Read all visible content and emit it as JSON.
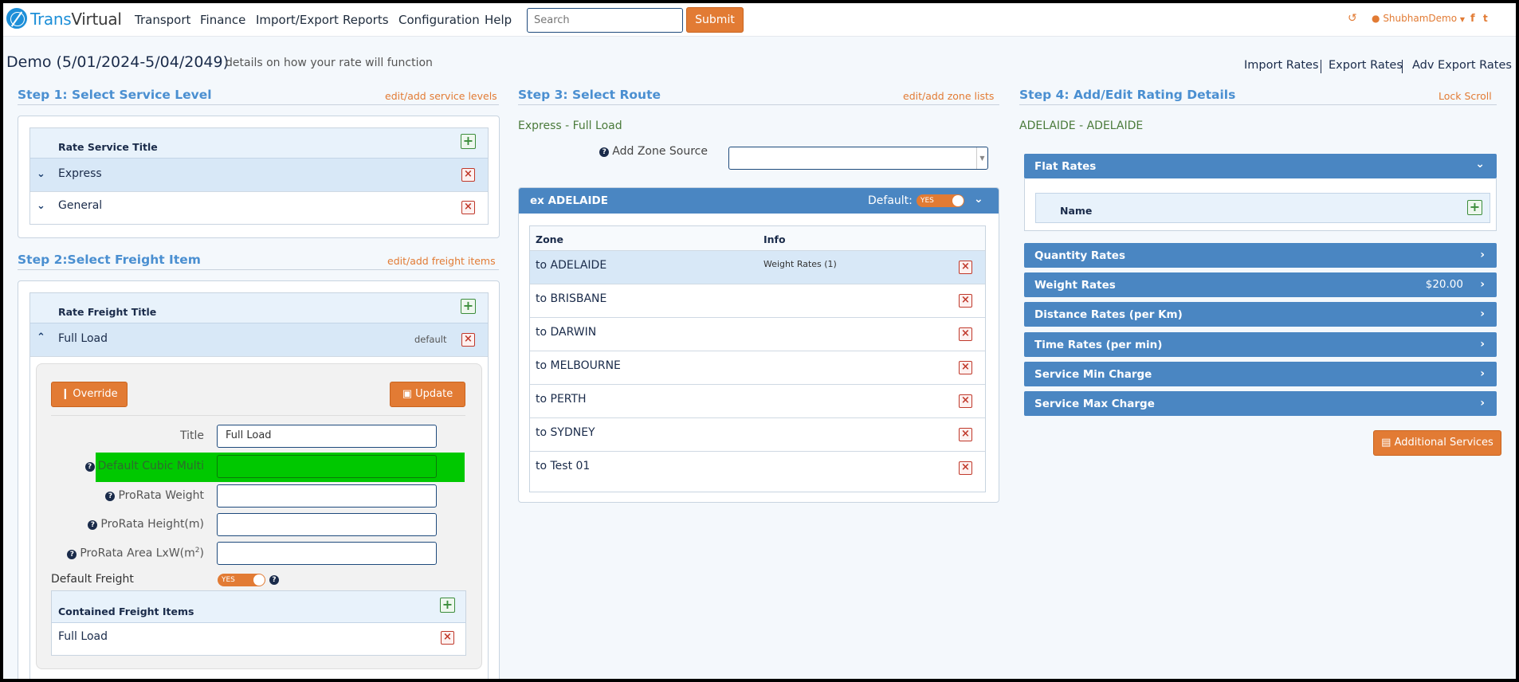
{
  "navbar": {
    "logo_trans": "Trans",
    "logo_virtual": "Virtual",
    "menu": [
      "Transport",
      "Finance",
      "Import/Export",
      "Reports",
      "Configuration",
      "Help"
    ],
    "search_placeholder": "Search",
    "submit_label": "Submit",
    "user": "ShubhamDemo",
    "icons": [
      "history-icon",
      "user-icon",
      "facebook-icon",
      "twitter-icon"
    ]
  },
  "header": {
    "title": "Demo (5/01/2024-5/04/2049)",
    "subtitle": "details on how your rate will function",
    "links": [
      "Import Rates",
      "Export Rates",
      "Adv Export Rates"
    ]
  },
  "step1": {
    "title": "Step 1: Select Service Level",
    "link": "edit/add service levels",
    "column": "Rate Service Title",
    "rows": [
      "Express",
      "General"
    ]
  },
  "step2": {
    "title": "Step 2:Select Freight Item",
    "link": "edit/add freight items",
    "column": "Rate Freight Title",
    "row": "Full Load",
    "row_badge": "default",
    "override_label": "Override",
    "update_label": "Update",
    "fields": {
      "title_label": "Title",
      "title_value": "Full Load",
      "cubic_label": "Default Cubic Multi",
      "prorata_weight_label": "ProRata Weight",
      "prorata_height_label": "ProRata Height(m)",
      "prorata_area_label": "ProRata Area LxW(m",
      "prorata_area_sup": "2",
      "prorata_area_close": ")",
      "default_freight_label": "Default Freight",
      "toggle_text": "YES"
    },
    "contained_title": "Contained Freight Items",
    "contained_rows": [
      "Full Load"
    ]
  },
  "step3": {
    "title": "Step 3: Select Route",
    "link": "edit/add zone lists",
    "route": "Express - Full Load",
    "zone_source_label": "Add Zone Source",
    "zone_source_value": "",
    "group_title": "ex ADELAIDE",
    "default_label": "Default:",
    "toggle_text": "YES",
    "columns": [
      "Zone",
      "Info"
    ],
    "zones": [
      {
        "zone": "to ADELAIDE",
        "info": "Weight Rates (1)"
      },
      {
        "zone": "to BRISBANE",
        "info": ""
      },
      {
        "zone": "to DARWIN",
        "info": ""
      },
      {
        "zone": "to MELBOURNE",
        "info": ""
      },
      {
        "zone": "to PERTH",
        "info": ""
      },
      {
        "zone": "to SYDNEY",
        "info": ""
      },
      {
        "zone": "to Test 01",
        "info": ""
      }
    ]
  },
  "step4": {
    "title": "Step 4: Add/Edit Rating Details",
    "link": "Lock Scroll",
    "route": "ADELAIDE - ADELAIDE",
    "flat_rates": "Flat Rates",
    "name_column": "Name",
    "sections": [
      {
        "label": "Quantity Rates",
        "value": ""
      },
      {
        "label": "Weight Rates",
        "value": "$20.00"
      },
      {
        "label": "Distance Rates (per Km)",
        "value": ""
      },
      {
        "label": "Time Rates (per min)",
        "value": ""
      },
      {
        "label": "Service Min Charge",
        "value": ""
      },
      {
        "label": "Service Max Charge",
        "value": ""
      }
    ],
    "additional_services": "Additional Services"
  },
  "colors": {
    "accent_orange": "#e27b34",
    "step_blue": "#4a8fd1",
    "bar_blue": "#4a86c2",
    "highlight_green": "#00c800",
    "route_green": "#4a7a3a"
  }
}
